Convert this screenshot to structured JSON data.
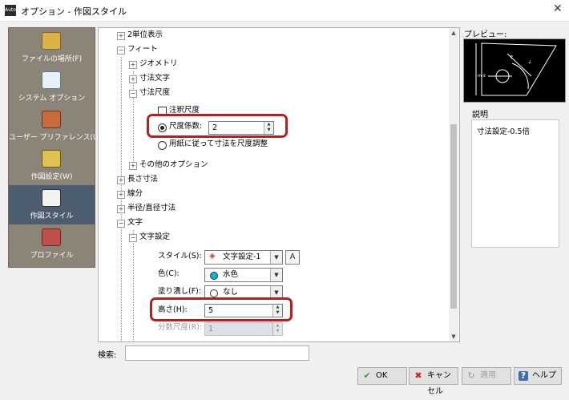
{
  "window": {
    "title": "オプション - 作図スタイル",
    "app_icon_text": "AutoCAD"
  },
  "nav": {
    "items": [
      {
        "label": "ファイルの場所(F)",
        "icon": "folder-icon"
      },
      {
        "label": "システム オプション",
        "icon": "system-options-icon"
      },
      {
        "label": "ユーザー プリファレンス(U)",
        "icon": "user-preferences-icon"
      },
      {
        "label": "作図設定(W)",
        "icon": "drawing-settings-icon"
      },
      {
        "label": "作図スタイル",
        "icon": "drawing-style-icon",
        "selected": true
      },
      {
        "label": "プロファイル",
        "icon": "profile-icon"
      }
    ]
  },
  "tree": {
    "unit_display": "2単位表示",
    "foot": "フィート",
    "geometry": "ジオメトリ",
    "dim_text": "寸法文字",
    "dim_scale": "寸法尺度",
    "annotative_scale": "注釈尺度",
    "scale_factor_label": "尺度係数:",
    "scale_factor_value": "2",
    "paper_scale_label": "用紙に従って寸法を尺度調整",
    "other_options": "その他のオプション",
    "length_dim": "長さ寸法",
    "leader": "線分",
    "radius_diameter": "半径/直径寸法",
    "text": "文字",
    "text_settings": "文字設定",
    "style_label": "スタイル(S):",
    "style_value": "文字設定-1",
    "color_label": "色(C):",
    "color_value": "水色",
    "fill_label": "塗り潰し(F):",
    "fill_value": "なし",
    "height_label": "高さ(H):",
    "height_value": "5",
    "fraction_scale_label": "分数尺度(R):",
    "fraction_scale_value": "1"
  },
  "preview": {
    "label": "プレビュー:"
  },
  "description": {
    "label": "説明",
    "text": "寸法設定-0.5倍"
  },
  "search": {
    "label": "検索:",
    "value": "",
    "placeholder": ""
  },
  "buttons": {
    "ok": "OK",
    "cancel": "キャンセル",
    "apply": "適用",
    "help": "ヘルプ"
  },
  "colors": {
    "nav_bg": "#8d8478",
    "nav_selected": "#4d5d70",
    "highlight": "#b22222",
    "cyan": "#00b7d8"
  }
}
